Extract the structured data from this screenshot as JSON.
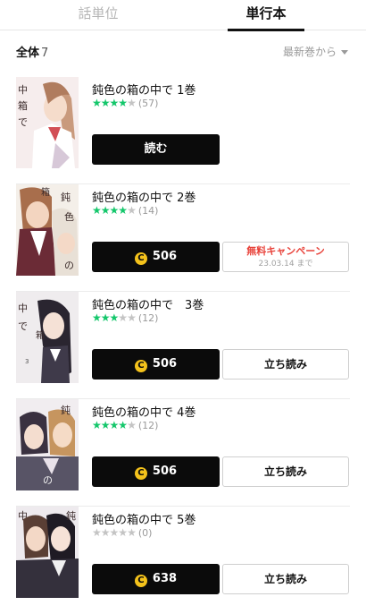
{
  "tabs": [
    {
      "label": "話単位",
      "active": false
    },
    {
      "label": "単行本",
      "active": true
    }
  ],
  "filter": {
    "all_label": "全体",
    "count": "7",
    "sort_label": "最新巻から"
  },
  "colors": {
    "star_on": "#14c76b",
    "star_off": "#c4c4c4",
    "coin": "#f4c21b",
    "campaign_red": "#e8423a"
  },
  "volumes": [
    {
      "title": "鈍色の箱の中で 1巻",
      "rating": 4,
      "review_count": "(57)",
      "read_label": "読む"
    },
    {
      "title": "鈍色の箱の中で 2巻",
      "rating": 4,
      "review_count": "(14)",
      "price": "506",
      "campaign_label": "無料キャンペーン",
      "campaign_until": "23.03.14 まで"
    },
    {
      "title": "鈍色の箱の中で　3巻",
      "rating": 3,
      "review_count": "(12)",
      "price": "506",
      "trial_label": "立ち読み"
    },
    {
      "title": "鈍色の箱の中で 4巻",
      "rating": 4,
      "review_count": "(12)",
      "price": "506",
      "trial_label": "立ち読み"
    },
    {
      "title": "鈍色の箱の中で 5巻",
      "rating": 0,
      "review_count": "(0)",
      "price": "638",
      "trial_label": "立ち読み"
    }
  ],
  "coin_glyph": "C",
  "icons": {
    "sort": "chevron-down-icon",
    "coin": "coin-icon",
    "star": "star-icon"
  }
}
